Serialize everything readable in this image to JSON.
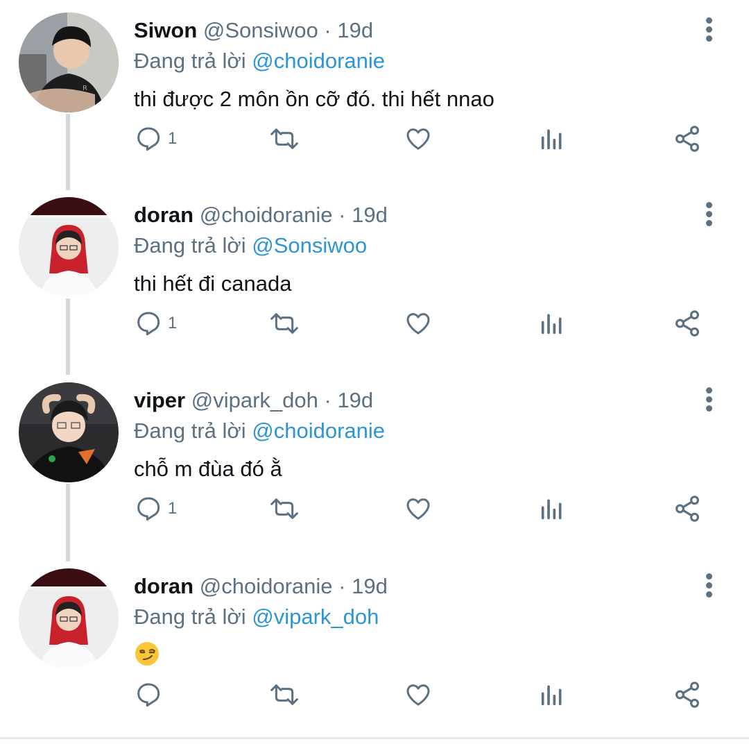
{
  "replies": [
    {
      "name": "Siwon",
      "handle": "@Sonsiwoo",
      "time": "19d",
      "replying_prefix": "Đang trả lời",
      "replying_to": "@choidoranie",
      "text": "thi được 2 môn ồn cỡ đó. thi hết nnao",
      "reply_count": "1"
    },
    {
      "name": "doran",
      "handle": "@choidoranie",
      "time": "19d",
      "replying_prefix": "Đang trả lời",
      "replying_to": "@Sonsiwoo",
      "text": "thi hết đi canada",
      "reply_count": "1"
    },
    {
      "name": "viper",
      "handle": "@vipark_doh",
      "time": "19d",
      "replying_prefix": "Đang trả lời",
      "replying_to": "@choidoranie",
      "text": "chỗ m đùa đó ằ",
      "reply_count": "1"
    },
    {
      "name": "doran",
      "handle": "@choidoranie",
      "time": "19d",
      "replying_prefix": "Đang trả lời",
      "replying_to": "@vipark_doh",
      "text": "",
      "emoji": "smirking-face-emoji",
      "reply_count": ""
    }
  ],
  "separator": "·",
  "colors": {
    "mention": "#2b95d6",
    "secondary_text": "#5b7083",
    "thread_line": "#d4d8dc"
  },
  "icons": [
    "reply-icon",
    "retweet-icon",
    "like-icon",
    "analytics-icon",
    "share-icon",
    "more-options-icon"
  ]
}
